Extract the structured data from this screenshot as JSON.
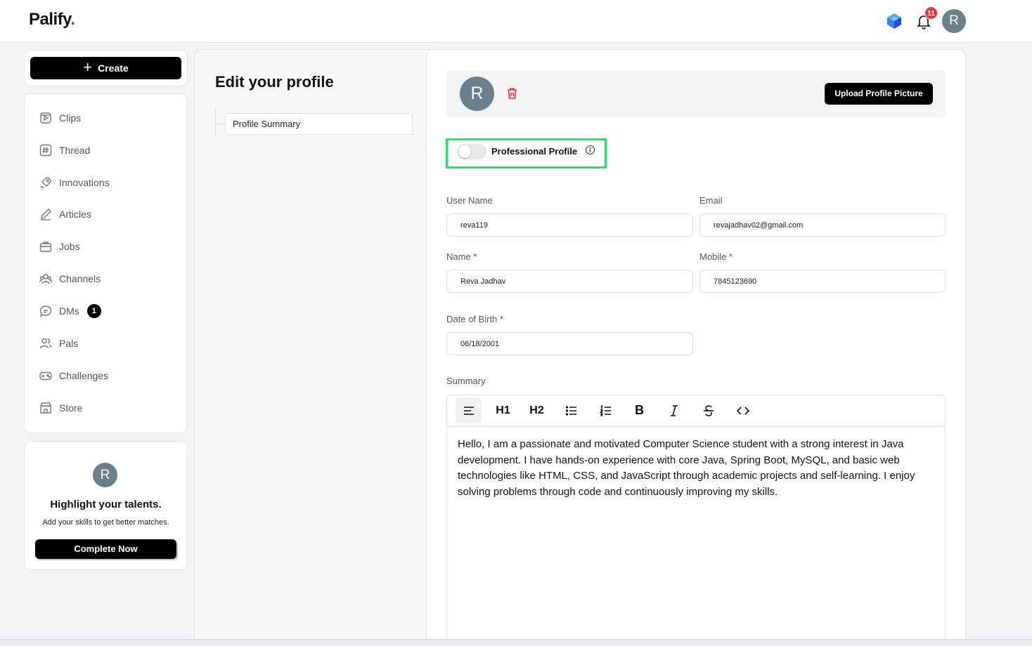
{
  "app": {
    "logo_text": "Palify",
    "logo_dot": "."
  },
  "header": {
    "notification_count": "11",
    "avatar_initial": "R"
  },
  "sidebar": {
    "create_label": "Create",
    "items": [
      {
        "label": "Clips",
        "icon": "clips-icon"
      },
      {
        "label": "Thread",
        "icon": "hash-icon"
      },
      {
        "label": "Innovations",
        "icon": "rocket-icon"
      },
      {
        "label": "Articles",
        "icon": "pen-icon"
      },
      {
        "label": "Jobs",
        "icon": "briefcase-icon"
      },
      {
        "label": "Channels",
        "icon": "channels-icon"
      },
      {
        "label": "DMs",
        "icon": "chat-icon",
        "badge": "1"
      },
      {
        "label": "Pals",
        "icon": "people-icon"
      },
      {
        "label": "Challenges",
        "icon": "gamepad-icon"
      },
      {
        "label": "Store",
        "icon": "store-icon"
      }
    ],
    "promo": {
      "avatar_initial": "R",
      "title": "Highlight your talents.",
      "subtitle": "Add your skills to get better matches.",
      "button_label": "Complete Now"
    }
  },
  "main": {
    "title": "Edit your profile",
    "tabs": [
      {
        "label": "Profile Summary"
      }
    ],
    "avatar_initial": "R",
    "upload_label": "Upload Profile Picture",
    "professional_profile": {
      "label": "Professional Profile",
      "enabled": false
    },
    "fields": {
      "username": {
        "label": "User Name",
        "value": "reva119"
      },
      "email": {
        "label": "Email",
        "value": "revajadhav02@gmail.com"
      },
      "name": {
        "label": "Name *",
        "value": "Reva Jadhav"
      },
      "mobile": {
        "label": "Mobile *",
        "value": "7845123690"
      },
      "dob": {
        "label": "Date of Birth *",
        "value": "06/18/2001"
      }
    },
    "summary": {
      "label": "Summary",
      "toolbar": [
        "paragraph",
        "H1",
        "H2",
        "bullet-list",
        "ordered-list",
        "B",
        "I",
        "S",
        "code"
      ],
      "h1_label": "H1",
      "h2_label": "H2",
      "bold_label": "B",
      "text": "Hello, I am a passionate and motivated Computer Science student with a strong interest in Java development. I have hands-on experience with core Java, Spring Boot, MySQL, and basic web technologies like HTML, CSS, and JavaScript through academic projects and self-learning. I enjoy solving problems through code and continuously improving my skills."
    }
  },
  "colors": {
    "accent": "#2563eb",
    "highlight_border": "#22e36a",
    "badge_red": "#e5383b",
    "avatar_bg": "#6b7f8c",
    "delete_red": "#e5383b"
  }
}
